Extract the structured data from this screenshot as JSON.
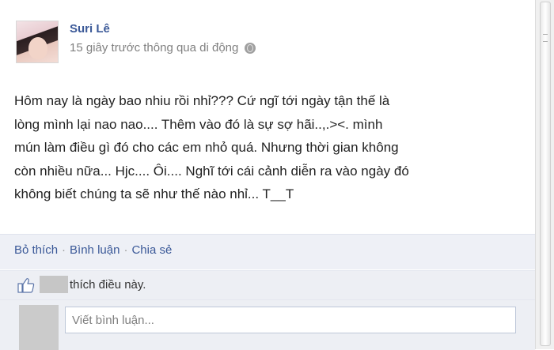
{
  "post": {
    "author": "Suri Lê",
    "timestamp": "15 giây trước thông qua di động",
    "privacy_icon": "globe-icon",
    "body_lines": [
      "Hôm nay là ngày bao nhiu rồi nhỉ??? Cứ ngĩ tới ngày tận thế là",
      "lòng mình lại nao nao.... Thêm vào đó là sự sợ hãi..,.><. mình",
      "mún làm điều gì đó cho các em nhỏ quá. Nhưng thời gian không",
      "còn nhiều nữa... Hjc.... Ôi.... Nghĩ tới cái cảnh diễn ra vào ngày đó",
      "không biết chúng ta sẽ như thế nào nhỉ... T__T"
    ]
  },
  "actions": {
    "like": "Bỏ thích",
    "separator": "·",
    "comment": "Bình luận",
    "share": "Chia sẻ"
  },
  "likes": {
    "text": "thích điều này."
  },
  "comment_box": {
    "placeholder": "Viết bình luận..."
  },
  "colors": {
    "link": "#3b5998",
    "bar_background": "#edeff4",
    "meta_text": "#808080"
  }
}
